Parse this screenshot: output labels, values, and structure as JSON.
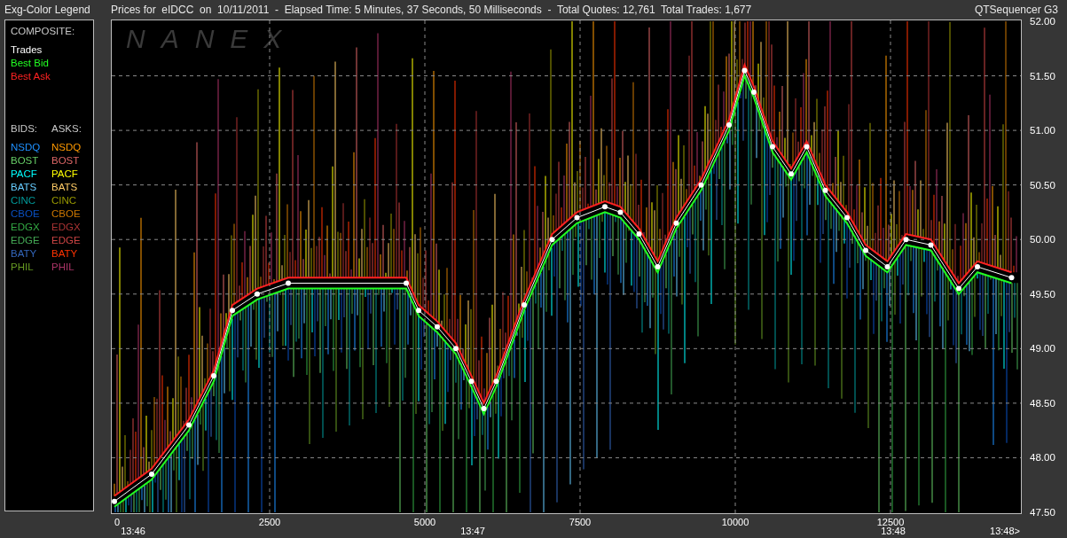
{
  "legend_panel": {
    "title": "Exg-Color Legend",
    "composite_heading": "COMPOSITE:",
    "bids_heading": "BIDS:",
    "asks_heading": "ASKS:",
    "bids": [
      {
        "label": "NSDQ",
        "color": "#1e90ff"
      },
      {
        "label": "BOST",
        "color": "#66cc66"
      },
      {
        "label": "PACF",
        "color": "#00ffff"
      },
      {
        "label": "BATS",
        "color": "#66ccff"
      },
      {
        "label": "CINC",
        "color": "#009999"
      },
      {
        "label": "CBOE",
        "color": "#0a4fc0"
      },
      {
        "label": "EDGX",
        "color": "#33aa44"
      },
      {
        "label": "EDGE",
        "color": "#44aa55"
      },
      {
        "label": "BATY",
        "color": "#3366bb"
      },
      {
        "label": "PHIL",
        "color": "#669922"
      }
    ],
    "asks": [
      {
        "label": "NSDQ",
        "color": "#ff9900"
      },
      {
        "label": "BOST",
        "color": "#dd6666"
      },
      {
        "label": "PACF",
        "color": "#ffff00"
      },
      {
        "label": "BATS",
        "color": "#ffcc66"
      },
      {
        "label": "CINC",
        "color": "#999900"
      },
      {
        "label": "CBOE",
        "color": "#cc7700"
      },
      {
        "label": "EDGX",
        "color": "#aa3333"
      },
      {
        "label": "EDGE",
        "color": "#cc4444"
      },
      {
        "label": "BATY",
        "color": "#ff3300"
      },
      {
        "label": "PHIL",
        "color": "#aa3366"
      }
    ]
  },
  "header": {
    "title": "Prices for  eIDCC  on  10/11/2011  -  Elapsed Time: 5 Minutes, 37 Seconds, 50 Milliseconds  -  Total Quotes: 12,761  Total Trades: 1,677",
    "app_name": "QTSequencer G3"
  },
  "chart": {
    "watermark": "NANEX",
    "time_labels": [
      "13:46",
      "13:47",
      "13:48",
      "13:48>"
    ],
    "chart_data": {
      "type": "line",
      "grid": true,
      "x": [
        0,
        600,
        1200,
        1600,
        1900,
        2300,
        2800,
        4700,
        4900,
        5200,
        5500,
        5750,
        5950,
        6150,
        6600,
        7050,
        7450,
        7900,
        8150,
        8450,
        8750,
        9050,
        9450,
        9900,
        10150,
        10300,
        10600,
        10900,
        11150,
        11450,
        11800,
        12100,
        12450,
        12750,
        13150,
        13600,
        13900,
        14450
      ],
      "series": [
        {
          "name": "Trades",
          "color": "#ffffff",
          "marker": "circle",
          "values": [
            47.6,
            47.85,
            48.3,
            48.75,
            49.35,
            49.5,
            49.6,
            49.6,
            49.35,
            49.2,
            49.0,
            48.7,
            48.45,
            48.7,
            49.4,
            50.0,
            50.2,
            50.3,
            50.25,
            50.05,
            49.75,
            50.15,
            50.5,
            51.05,
            51.55,
            51.35,
            50.85,
            50.6,
            50.85,
            50.45,
            50.2,
            49.9,
            49.75,
            50.0,
            49.95,
            49.55,
            49.75,
            49.65
          ]
        },
        {
          "name": "Best Bid",
          "color": "#22ff22",
          "values": [
            47.55,
            47.8,
            48.25,
            48.7,
            49.3,
            49.45,
            49.55,
            49.55,
            49.3,
            49.15,
            48.95,
            48.65,
            48.4,
            48.65,
            49.35,
            49.95,
            50.15,
            50.25,
            50.2,
            50.0,
            49.7,
            50.1,
            50.45,
            51.0,
            51.5,
            51.3,
            50.8,
            50.55,
            50.8,
            50.4,
            50.15,
            49.85,
            49.7,
            49.95,
            49.9,
            49.5,
            49.7,
            49.6
          ]
        },
        {
          "name": "Best Ask",
          "color": "#ff2222",
          "values": [
            47.65,
            47.9,
            48.35,
            48.8,
            49.4,
            49.55,
            49.65,
            49.65,
            49.4,
            49.25,
            49.05,
            48.75,
            48.5,
            48.75,
            49.45,
            50.05,
            50.25,
            50.35,
            50.3,
            50.1,
            49.8,
            50.2,
            50.55,
            51.1,
            51.6,
            51.4,
            50.9,
            50.65,
            50.9,
            50.5,
            50.25,
            49.95,
            49.8,
            50.05,
            50.0,
            49.6,
            49.8,
            49.7
          ]
        }
      ],
      "xlim": [
        0,
        14600
      ],
      "ylim": [
        47.5,
        52
      ],
      "xticks": [
        0,
        2500,
        5000,
        7500,
        10000,
        12500
      ],
      "yticks": [
        {
          "value": 52,
          "label": "52.00"
        },
        {
          "value": 51.5,
          "label": "51.50"
        },
        {
          "value": 51,
          "label": "51.00"
        },
        {
          "value": 50.5,
          "label": "50.50"
        },
        {
          "value": 50,
          "label": "50.00"
        },
        {
          "value": 49.5,
          "label": "49.50"
        },
        {
          "value": 49,
          "label": "49.00"
        },
        {
          "value": 48.5,
          "label": "48.50"
        },
        {
          "value": 48,
          "label": "48.00"
        },
        {
          "value": 47.5,
          "label": "47.50"
        }
      ]
    }
  }
}
